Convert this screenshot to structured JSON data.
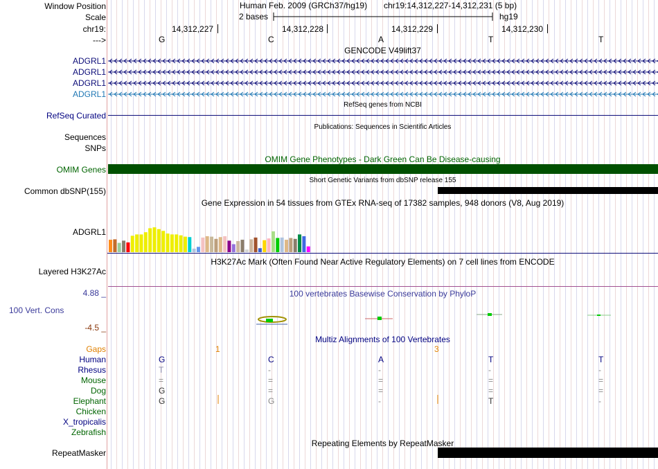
{
  "header": {
    "window_position_label": "Window Position",
    "scale_label": "Scale",
    "chrom_label": "chr19:",
    "strand_label": "--->",
    "assembly_title": "Human Feb. 2009 (GRCh37/hg19)",
    "position_text": "chr19:14,312,227-14,312,231 (5 bp)",
    "scale_text": "2 bases",
    "db_text": "hg19",
    "coords": [
      "14,312,227",
      "14,312,228",
      "14,312,229",
      "14,312,230"
    ],
    "bases": [
      "G",
      "C",
      "A",
      "T",
      "T"
    ]
  },
  "gencode": {
    "title": "GENCODE V49lift37",
    "genes": [
      "ADGRL1",
      "ADGRL1",
      "ADGRL1",
      "ADGRL1"
    ],
    "colors": [
      "#0c0c78",
      "#0c0c78",
      "#0c0c78",
      "#1f77b4"
    ]
  },
  "refseq": {
    "title": "RefSeq genes from NCBI",
    "label": "RefSeq Curated"
  },
  "publications": {
    "title": "Publications: Sequences in Scientific Articles",
    "label_1": "Sequences",
    "label_2": "SNPs"
  },
  "omim": {
    "title": "OMIM Gene Phenotypes - Dark Green Can Be Disease-causing",
    "label": "OMIM Genes",
    "color": "#005000"
  },
  "dbsnp": {
    "title": "Short Genetic Variants from dbSNP release 155",
    "label": "Common dbSNP(155)"
  },
  "gtex": {
    "title": "Gene Expression in 54 tissues from GTEx RNA-seq of 17382 samples, 948 donors (V8, Aug 2019)",
    "label": "ADGRL1",
    "bars": [
      {
        "value": 0.28,
        "color": "#ff8c1a"
      },
      {
        "value": 0.29,
        "color": "#c46c2a"
      },
      {
        "value": 0.21,
        "color": "#9acd9a"
      },
      {
        "value": 0.26,
        "color": "#8b7d6b"
      },
      {
        "value": 0.22,
        "color": "#ff0000"
      },
      {
        "value": 0.37,
        "color": "#eeee00"
      },
      {
        "value": 0.4,
        "color": "#eeee00"
      },
      {
        "value": 0.4,
        "color": "#eeee00"
      },
      {
        "value": 0.45,
        "color": "#eeee00"
      },
      {
        "value": 0.54,
        "color": "#eeee00"
      },
      {
        "value": 0.56,
        "color": "#eeee00"
      },
      {
        "value": 0.52,
        "color": "#eeee00"
      },
      {
        "value": 0.48,
        "color": "#eeee00"
      },
      {
        "value": 0.42,
        "color": "#eeee00"
      },
      {
        "value": 0.4,
        "color": "#eeee00"
      },
      {
        "value": 0.4,
        "color": "#eeee00"
      },
      {
        "value": 0.38,
        "color": "#eeee00"
      },
      {
        "value": 0.35,
        "color": "#eeee00"
      },
      {
        "value": 0.34,
        "color": "#00ced1"
      },
      {
        "value": 0.08,
        "color": "#b0c4de"
      },
      {
        "value": 0.12,
        "color": "#6495ed"
      },
      {
        "value": 0.33,
        "color": "#f4c2c2"
      },
      {
        "value": 0.36,
        "color": "#deb887"
      },
      {
        "value": 0.35,
        "color": "#c8b89a"
      },
      {
        "value": 0.3,
        "color": "#bc9f7c"
      },
      {
        "value": 0.34,
        "color": "#deb887"
      },
      {
        "value": 0.36,
        "color": "#f4c2c2"
      },
      {
        "value": 0.26,
        "color": "#8b008b"
      },
      {
        "value": 0.18,
        "color": "#9370db"
      },
      {
        "value": 0.25,
        "color": "#cdb79e"
      },
      {
        "value": 0.28,
        "color": "#8b7d6b"
      },
      {
        "value": 0.06,
        "color": "#d3d3d3"
      },
      {
        "value": 0.29,
        "color": "#cdb79e"
      },
      {
        "value": 0.33,
        "color": "#a0522d"
      },
      {
        "value": 0.09,
        "color": "#3a5fcd"
      },
      {
        "value": 0.27,
        "color": "#ffd700"
      },
      {
        "value": 0.31,
        "color": "#ffb6c1"
      },
      {
        "value": 0.47,
        "color": "#aadd88"
      },
      {
        "value": 0.32,
        "color": "#00cc00"
      },
      {
        "value": 0.33,
        "color": "#b0c4de"
      },
      {
        "value": 0.28,
        "color": "#deb887"
      },
      {
        "value": 0.32,
        "color": "#bc9f7c"
      },
      {
        "value": 0.3,
        "color": "#8b7d6b"
      },
      {
        "value": 0.4,
        "color": "#008b45"
      },
      {
        "value": 0.36,
        "color": "#4169e1"
      },
      {
        "value": 0.13,
        "color": "#ff00ff"
      }
    ]
  },
  "h3k27ac": {
    "title": "H3K27Ac Mark (Often Found Near Active Regulatory Elements) on 7 cell lines from ENCODE",
    "label": "Layered H3K27Ac"
  },
  "phylop": {
    "title": "100 vertebrates Basewise Conservation by PhyloP",
    "label": "100 Vert. Cons",
    "max": "4.88 _",
    "min": "-4.5 _"
  },
  "multiz": {
    "title": "Multiz Alignments of 100 Vertebrates",
    "gaps_label": "Gaps",
    "gap_marks": [
      "1",
      "3"
    ],
    "species": [
      {
        "name": "Human",
        "color": "#000080",
        "cols": [
          "G",
          "C",
          "A",
          "T",
          "T"
        ],
        "text_color": "#000080"
      },
      {
        "name": "Rhesus",
        "color": "#000080",
        "cols": [
          "T",
          "-",
          "-",
          "-",
          "-"
        ],
        "text_color": "#8888aa"
      },
      {
        "name": "Mouse",
        "color": "#006400",
        "cols": [
          "=",
          "=",
          "=",
          "=",
          "="
        ],
        "text_color": "#888888"
      },
      {
        "name": "Dog",
        "color": "#006400",
        "cols": [
          "G",
          "=",
          "=",
          "=",
          "="
        ],
        "text_color": "#333333"
      },
      {
        "name": "Elephant",
        "color": "#006400",
        "cols": [
          "G",
          "G",
          "-",
          "T",
          "-"
        ],
        "text_color": "#333333"
      },
      {
        "name": "Chicken",
        "color": "#006400",
        "cols": [
          "",
          "",
          "",
          "",
          ""
        ],
        "text_color": "#333333"
      },
      {
        "name": "X_tropicalis",
        "color": "#000080",
        "cols": [
          "",
          "",
          "",
          "",
          ""
        ],
        "text_color": "#333333"
      },
      {
        "name": "Zebrafish",
        "color": "#006400",
        "cols": [
          "",
          "",
          "",
          "",
          ""
        ],
        "text_color": "#333333"
      }
    ]
  },
  "repeatmasker": {
    "title": "Repeating Elements by RepeatMasker",
    "label": "RepeatMasker"
  }
}
